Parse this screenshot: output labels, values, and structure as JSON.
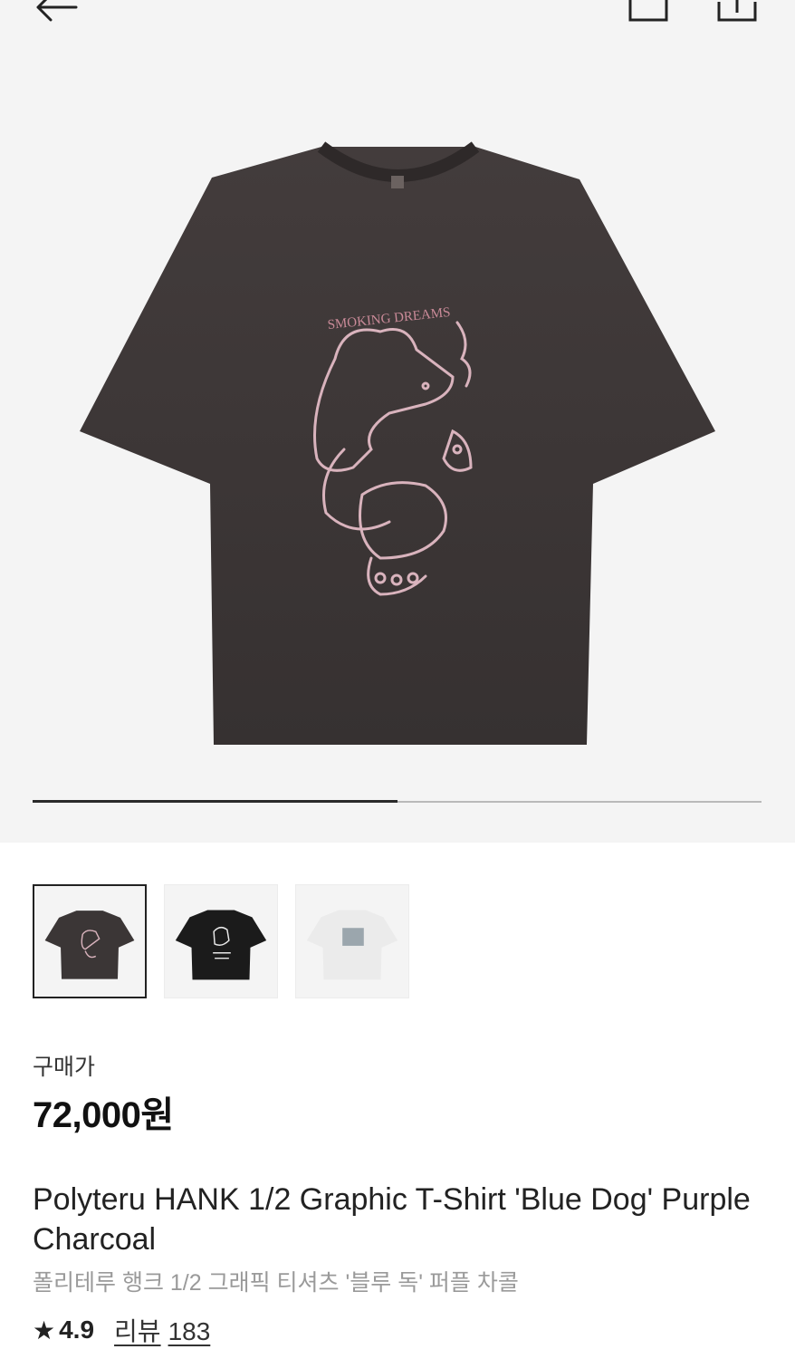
{
  "header": {
    "back_icon": "arrow-left-icon",
    "bag_icon": "shopping-bag-icon",
    "share_icon": "share-icon"
  },
  "product_image": {
    "shirt_color": "#3b3636",
    "print_color": "#d9b3bd",
    "print_text": "SMOKING DREAMS",
    "page_indicator_progress": 0.5
  },
  "thumbnails": [
    {
      "alt": "purple-charcoal-shirt",
      "color": "#3b3636",
      "selected": true
    },
    {
      "alt": "black-shirt",
      "color": "#1b1b1b",
      "selected": false
    },
    {
      "alt": "white-shirt",
      "color": "#ebebeb",
      "selected": false
    }
  ],
  "price": {
    "label": "구매가",
    "value": "72,000원"
  },
  "product": {
    "name_en": "Polyteru HANK 1/2 Graphic T-Shirt 'Blue Dog' Purple Charcoal",
    "name_ko": "폴리테루 행크 1/2 그래픽 티셔츠 '블루 독' 퍼플 차콜"
  },
  "rating": {
    "star_icon": "star-icon",
    "score": "4.9",
    "reviews_label": "리뷰",
    "reviews_count": "183"
  }
}
